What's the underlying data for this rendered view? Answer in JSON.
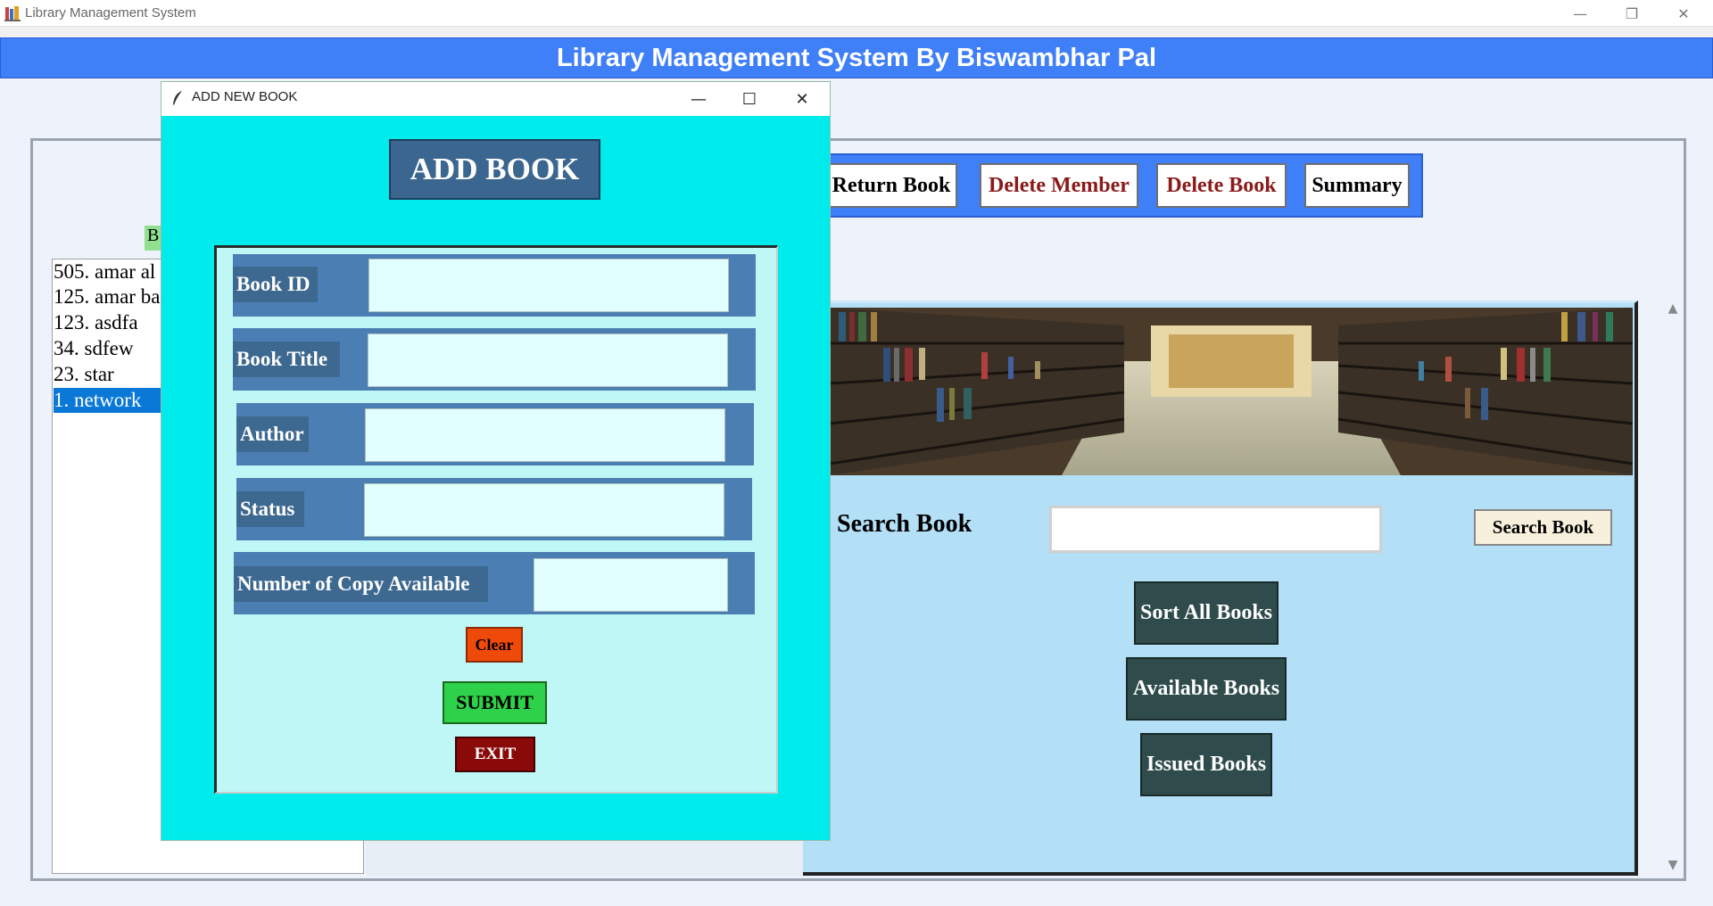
{
  "window": {
    "title": "Library Management System",
    "minimize_glyph": "—",
    "restore_glyph": "❐",
    "close_glyph": "✕"
  },
  "banner": {
    "title": "Library Management System By Biswambhar Pal"
  },
  "sidebar": {
    "green_button_label": "B",
    "books": [
      {
        "label": "505. amar al"
      },
      {
        "label": "125. amar ba"
      },
      {
        "label": "123. asdfa"
      },
      {
        "label": "34. sdfew"
      },
      {
        "label": "23. star"
      },
      {
        "label": "1. network",
        "selected": true
      }
    ]
  },
  "toolbar": {
    "return_book": "Return Book",
    "delete_member": "Delete Member",
    "delete_book": "Delete Book",
    "summary": "Summary"
  },
  "search": {
    "label": "Search Book",
    "value": "",
    "button": "Search Book"
  },
  "actions": {
    "sort_all": "Sort All Books",
    "available": "Available Books",
    "issued": "Issued Books"
  },
  "scroll": {
    "up": "▲",
    "down": "▼"
  },
  "dialog": {
    "title": "ADD NEW BOOK",
    "minimize_glyph": "—",
    "maximize_glyph": "☐",
    "close_glyph": "✕",
    "heading": "ADD BOOK",
    "fields": [
      {
        "label": "Book ID",
        "value": ""
      },
      {
        "label": "Book Title",
        "value": ""
      },
      {
        "label": "Author",
        "value": ""
      },
      {
        "label": "Status",
        "value": ""
      },
      {
        "label": "Number of Copy Available",
        "value": ""
      }
    ],
    "clear": "Clear",
    "submit": "SUBMIT",
    "exit": "EXIT"
  },
  "colors": {
    "banner": "#3f7ff8",
    "dialog_bg": "#00ebeb",
    "form_bg": "#bff7f7",
    "right_panel": "#b3dff7",
    "clear_button": "#f04a0a",
    "submit_button": "#2ed24a",
    "exit_button": "#8a0a0a"
  }
}
